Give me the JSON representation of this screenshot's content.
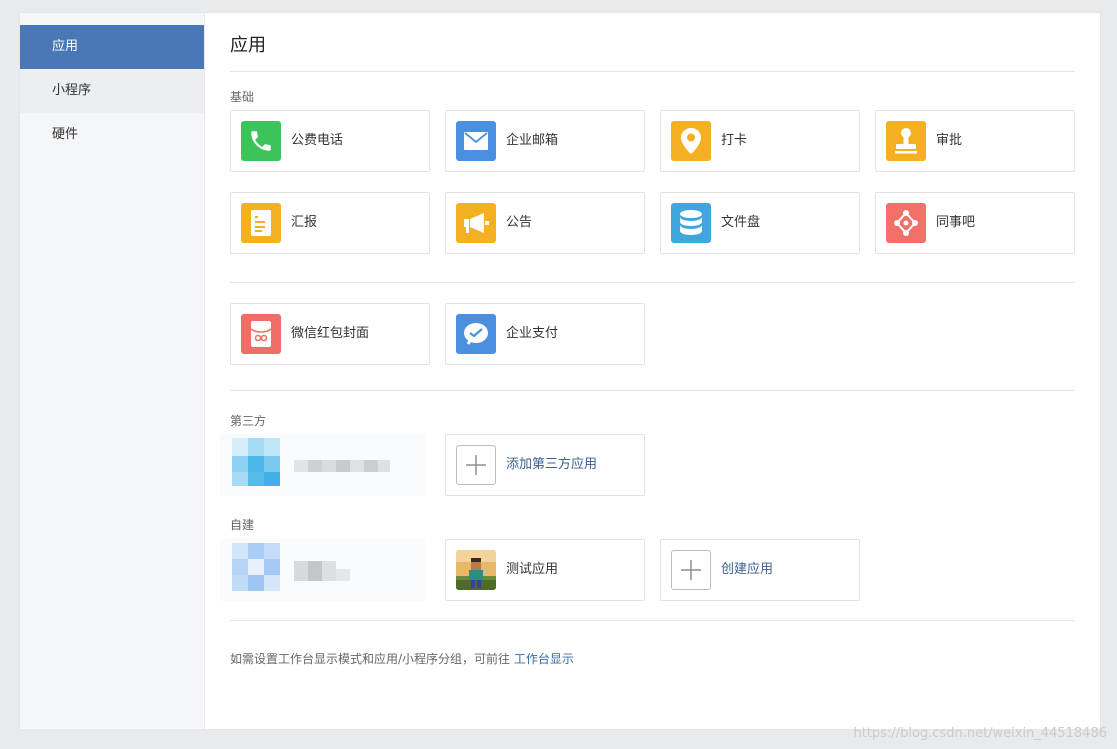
{
  "sidebar": {
    "items": [
      {
        "label": "应用",
        "active": true
      },
      {
        "label": "小程序",
        "active": false
      },
      {
        "label": "硬件",
        "active": false
      }
    ]
  },
  "main": {
    "title": "应用",
    "sections": {
      "basic": {
        "label": "基础",
        "apps": [
          {
            "label": "公费电话",
            "icon": "phone-icon",
            "color": "#3cc45a"
          },
          {
            "label": "企业邮箱",
            "icon": "mail-icon",
            "color": "#4a8fe0"
          },
          {
            "label": "打卡",
            "icon": "location-pin-icon",
            "color": "#f4b021"
          },
          {
            "label": "审批",
            "icon": "stamp-icon",
            "color": "#f4b021"
          },
          {
            "label": "汇报",
            "icon": "report-document-icon",
            "color": "#f4b021"
          },
          {
            "label": "公告",
            "icon": "megaphone-icon",
            "color": "#f4b021"
          },
          {
            "label": "文件盘",
            "icon": "database-disk-icon",
            "color": "#3ea8de"
          },
          {
            "label": "同事吧",
            "icon": "network-nodes-icon",
            "color": "#f27069"
          }
        ]
      },
      "extra": {
        "apps": [
          {
            "label": "微信红包封面",
            "icon": "red-envelope-icon",
            "color": "#ef6f66"
          },
          {
            "label": "企业支付",
            "icon": "payment-check-icon",
            "color": "#4a8fe0"
          }
        ]
      },
      "third_party": {
        "label": "第三方",
        "add_label": "添加第三方应用"
      },
      "custom": {
        "label": "自建",
        "apps": [
          {
            "label": "测试应用",
            "icon": "game-character-icon"
          }
        ],
        "create_label": "创建应用"
      }
    },
    "footer": {
      "text": "如需设置工作台显示模式和应用/小程序分组，可前往",
      "link": "工作台显示"
    }
  },
  "watermark": "https://blog.csdn.net/weixin_44518486",
  "colors": {
    "accent": "#4a77b6",
    "sidebar_bg": "#f5f6f8",
    "page_bg": "#e9eaec",
    "link": "#3b6aa8"
  }
}
